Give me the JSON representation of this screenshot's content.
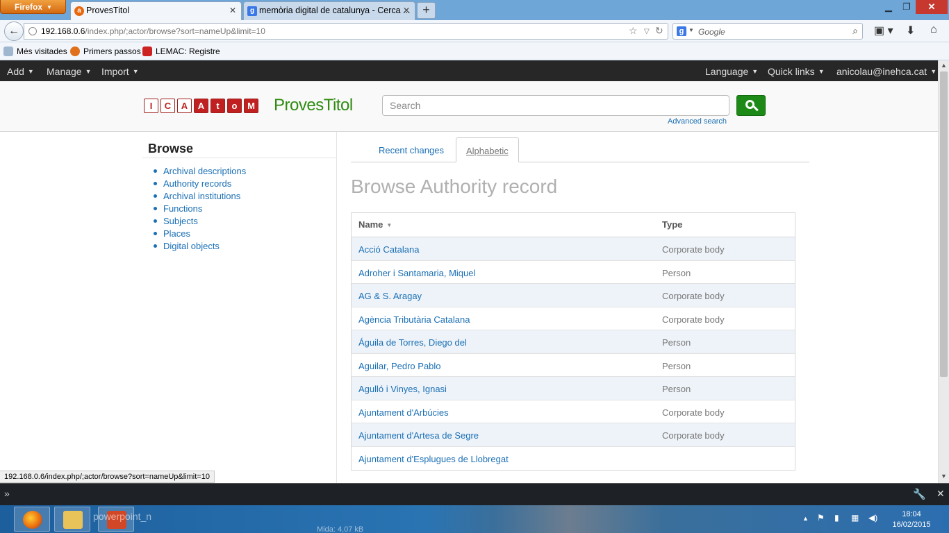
{
  "browser": {
    "menu_label": "Firefox",
    "tabs": [
      {
        "title": "ProvesTitol"
      },
      {
        "title": "memòria digital de catalunya - Cerca ..."
      }
    ],
    "url_host": "192.168.0.6",
    "url_path": "/index.php/;actor/browse?sort=nameUp&limit=10",
    "search_placeholder": "Google",
    "bookmarks": [
      "Més visitades",
      "Primers passos",
      "LEMAC: Registre"
    ],
    "status_url": "192.168.0.6/index.php/;actor/browse?sort=nameUp&limit=10"
  },
  "userbar": {
    "left_menus": [
      "Add",
      "Manage",
      "Import"
    ],
    "right_menus": [
      "Language",
      "Quick links",
      "anicolau@inehca.cat"
    ]
  },
  "header": {
    "logo_letters": [
      "I",
      "C",
      "A",
      "A",
      "t",
      "o",
      "M"
    ],
    "site_name": "ProvesTitol",
    "search_placeholder": "Search",
    "advanced_search": "Advanced search"
  },
  "sidebar": {
    "title": "Browse",
    "items": [
      "Archival descriptions",
      "Authority records",
      "Archival institutions",
      "Functions",
      "Subjects",
      "Places",
      "Digital objects"
    ]
  },
  "main": {
    "tabs": [
      "Recent changes",
      "Alphabetic"
    ],
    "active_tab": "Alphabetic",
    "title": "Browse Authority record",
    "columns": [
      "Name",
      "Type"
    ],
    "rows": [
      {
        "name": "Acció Catalana",
        "type": "Corporate body"
      },
      {
        "name": "Adroher i Santamaria, Miquel",
        "type": "Person"
      },
      {
        "name": "AG & S. Aragay",
        "type": "Corporate body"
      },
      {
        "name": "Agència Tributària Catalana",
        "type": "Corporate body"
      },
      {
        "name": "Águila de Torres, Diego del",
        "type": "Person"
      },
      {
        "name": "Aguilar, Pedro Pablo",
        "type": "Person"
      },
      {
        "name": "Agulló i Vinyes, Ignasi",
        "type": "Person"
      },
      {
        "name": "Ajuntament d'Arbúcies",
        "type": "Corporate body"
      },
      {
        "name": "Ajuntament d'Artesa de Segre",
        "type": "Corporate body"
      },
      {
        "name": "Ajuntament d'Esplugues de Llobregat",
        "type": ""
      }
    ]
  },
  "taskbar": {
    "ghost_text": "powerpoint_n",
    "ghost_size": "Mida: 4,07 kB",
    "time": "18:04",
    "date": "16/02/2015"
  },
  "colors": {
    "accent_link": "#1a6fb5",
    "brand_green": "#2e8b10",
    "logo_red": "#c02020"
  }
}
